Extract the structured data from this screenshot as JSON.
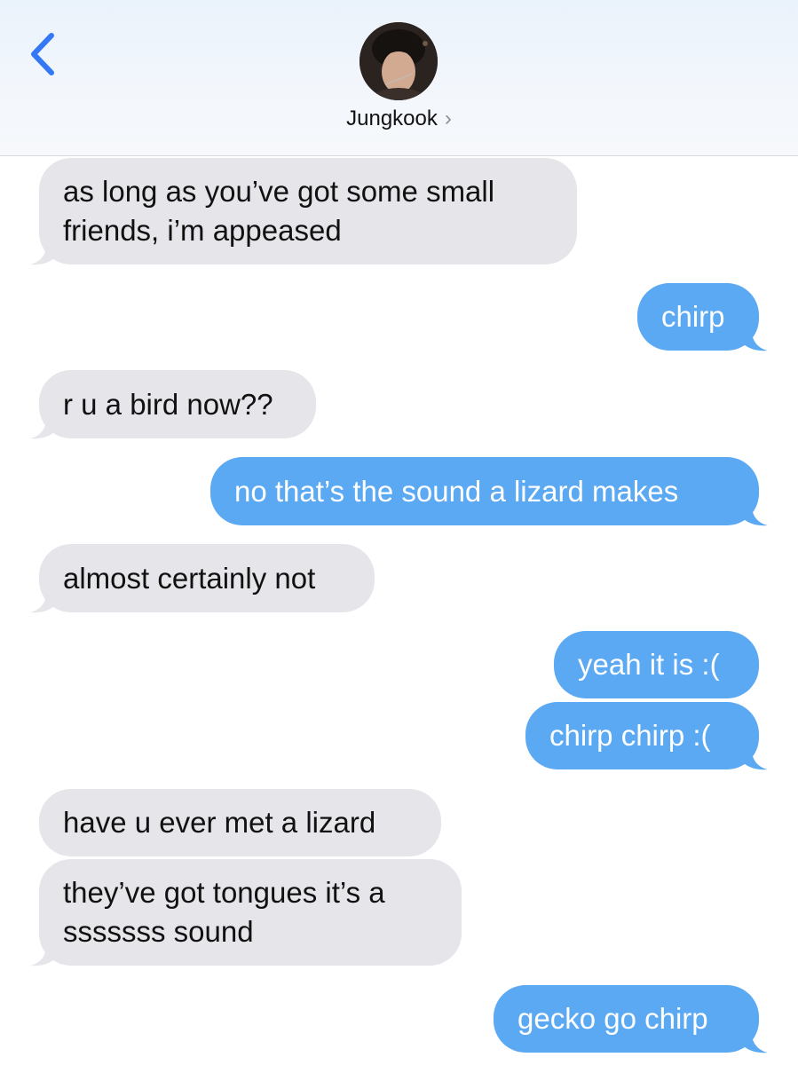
{
  "header": {
    "back_icon": "chevron-left-icon",
    "contact_name": "Jungkook",
    "chevron": "›"
  },
  "colors": {
    "incoming_bubble": "#e5e5ea",
    "outgoing_bubble": "#5aa9f2",
    "back_accent": "#3478f6"
  },
  "messages": [
    {
      "side": "in",
      "text": "as long as you’ve got some small\nfriends, i’m appeased"
    },
    {
      "side": "out",
      "text": "chirp"
    },
    {
      "side": "in",
      "text": "r u a bird now??"
    },
    {
      "side": "out",
      "text": "no that’s the sound a lizard makes"
    },
    {
      "side": "in",
      "text": "almost certainly not"
    },
    {
      "side": "out",
      "text": "yeah it is :("
    },
    {
      "side": "out",
      "text": "chirp chirp :("
    },
    {
      "side": "in",
      "text": "have u ever met a lizard"
    },
    {
      "side": "in",
      "text": "they’ve got tongues it’s a\nsssssss sound"
    },
    {
      "side": "out",
      "text": "gecko go chirp"
    }
  ]
}
